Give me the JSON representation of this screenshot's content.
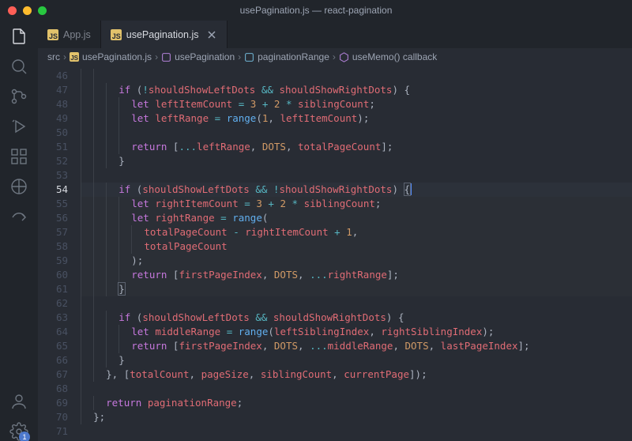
{
  "window": {
    "title": "usePagination.js — react-pagination"
  },
  "tabs": [
    {
      "label": "App.js",
      "active": false
    },
    {
      "label": "usePagination.js",
      "active": true
    }
  ],
  "breadcrumbs": {
    "root": "src",
    "file": "usePagination.js",
    "symbols": [
      "usePagination",
      "paginationRange",
      "useMemo() callback"
    ]
  },
  "activitybar": {
    "settings_badge": "1"
  },
  "editor": {
    "active_line": 54,
    "lines": [
      {
        "n": 46,
        "i": 2,
        "t": []
      },
      {
        "n": 47,
        "i": 3,
        "t": [
          [
            "kw",
            "if"
          ],
          [
            "punc",
            " ("
          ],
          [
            "op",
            "!"
          ],
          [
            "var",
            "shouldShowLeftDots"
          ],
          [
            "punc",
            " "
          ],
          [
            "op",
            "&&"
          ],
          [
            "punc",
            " "
          ],
          [
            "var",
            "shouldShowRightDots"
          ],
          [
            "punc",
            ") {"
          ]
        ]
      },
      {
        "n": 48,
        "i": 4,
        "t": [
          [
            "kw",
            "let"
          ],
          [
            "punc",
            " "
          ],
          [
            "var",
            "leftItemCount"
          ],
          [
            "punc",
            " "
          ],
          [
            "op",
            "="
          ],
          [
            "punc",
            " "
          ],
          [
            "num",
            "3"
          ],
          [
            "punc",
            " "
          ],
          [
            "op",
            "+"
          ],
          [
            "punc",
            " "
          ],
          [
            "num",
            "2"
          ],
          [
            "punc",
            " "
          ],
          [
            "op",
            "*"
          ],
          [
            "punc",
            " "
          ],
          [
            "var",
            "siblingCount"
          ],
          [
            "punc",
            ";"
          ]
        ]
      },
      {
        "n": 49,
        "i": 4,
        "t": [
          [
            "kw",
            "let"
          ],
          [
            "punc",
            " "
          ],
          [
            "var",
            "leftRange"
          ],
          [
            "punc",
            " "
          ],
          [
            "op",
            "="
          ],
          [
            "punc",
            " "
          ],
          [
            "fn",
            "range"
          ],
          [
            "punc",
            "("
          ],
          [
            "num",
            "1"
          ],
          [
            "punc",
            ", "
          ],
          [
            "var",
            "leftItemCount"
          ],
          [
            "punc",
            ");"
          ]
        ]
      },
      {
        "n": 50,
        "i": 4,
        "t": []
      },
      {
        "n": 51,
        "i": 4,
        "t": [
          [
            "kw",
            "return"
          ],
          [
            "punc",
            " ["
          ],
          [
            "op",
            "..."
          ],
          [
            "var",
            "leftRange"
          ],
          [
            "punc",
            ", "
          ],
          [
            "const",
            "DOTS"
          ],
          [
            "punc",
            ", "
          ],
          [
            "var",
            "totalPageCount"
          ],
          [
            "punc",
            "];"
          ]
        ]
      },
      {
        "n": 52,
        "i": 3,
        "t": [
          [
            "punc",
            "}"
          ]
        ]
      },
      {
        "n": 53,
        "i": 2,
        "t": []
      },
      {
        "n": 54,
        "i": 3,
        "hl": true,
        "t": [
          [
            "kw",
            "if"
          ],
          [
            "punc",
            " ("
          ],
          [
            "var",
            "shouldShowLeftDots"
          ],
          [
            "punc",
            " "
          ],
          [
            "op",
            "&&"
          ],
          [
            "punc",
            " "
          ],
          [
            "op",
            "!"
          ],
          [
            "var",
            "shouldShowRightDots"
          ],
          [
            "punc",
            ") "
          ],
          [
            "br",
            "{"
          ],
          [
            "cursor",
            ""
          ]
        ]
      },
      {
        "n": 55,
        "i": 4,
        "blk": true,
        "t": [
          [
            "kw",
            "let"
          ],
          [
            "punc",
            " "
          ],
          [
            "var",
            "rightItemCount"
          ],
          [
            "punc",
            " "
          ],
          [
            "op",
            "="
          ],
          [
            "punc",
            " "
          ],
          [
            "num",
            "3"
          ],
          [
            "punc",
            " "
          ],
          [
            "op",
            "+"
          ],
          [
            "punc",
            " "
          ],
          [
            "num",
            "2"
          ],
          [
            "punc",
            " "
          ],
          [
            "op",
            "*"
          ],
          [
            "punc",
            " "
          ],
          [
            "var",
            "siblingCount"
          ],
          [
            "punc",
            ";"
          ]
        ]
      },
      {
        "n": 56,
        "i": 4,
        "blk": true,
        "t": [
          [
            "kw",
            "let"
          ],
          [
            "punc",
            " "
          ],
          [
            "var",
            "rightRange"
          ],
          [
            "punc",
            " "
          ],
          [
            "op",
            "="
          ],
          [
            "punc",
            " "
          ],
          [
            "fn",
            "range"
          ],
          [
            "punc",
            "("
          ]
        ]
      },
      {
        "n": 57,
        "i": 5,
        "blk": true,
        "t": [
          [
            "var",
            "totalPageCount"
          ],
          [
            "punc",
            " "
          ],
          [
            "op",
            "-"
          ],
          [
            "punc",
            " "
          ],
          [
            "var",
            "rightItemCount"
          ],
          [
            "punc",
            " "
          ],
          [
            "op",
            "+"
          ],
          [
            "punc",
            " "
          ],
          [
            "num",
            "1"
          ],
          [
            "punc",
            ","
          ]
        ]
      },
      {
        "n": 58,
        "i": 5,
        "blk": true,
        "t": [
          [
            "var",
            "totalPageCount"
          ]
        ]
      },
      {
        "n": 59,
        "i": 4,
        "blk": true,
        "t": [
          [
            "punc",
            ");"
          ]
        ]
      },
      {
        "n": 60,
        "i": 4,
        "blk": true,
        "t": [
          [
            "kw",
            "return"
          ],
          [
            "punc",
            " ["
          ],
          [
            "var",
            "firstPageIndex"
          ],
          [
            "punc",
            ", "
          ],
          [
            "const",
            "DOTS"
          ],
          [
            "punc",
            ", "
          ],
          [
            "op",
            "..."
          ],
          [
            "var",
            "rightRange"
          ],
          [
            "punc",
            "];"
          ]
        ]
      },
      {
        "n": 61,
        "i": 3,
        "blk": true,
        "t": [
          [
            "br",
            "}"
          ]
        ]
      },
      {
        "n": 62,
        "i": 2,
        "t": []
      },
      {
        "n": 63,
        "i": 3,
        "t": [
          [
            "kw",
            "if"
          ],
          [
            "punc",
            " ("
          ],
          [
            "var",
            "shouldShowLeftDots"
          ],
          [
            "punc",
            " "
          ],
          [
            "op",
            "&&"
          ],
          [
            "punc",
            " "
          ],
          [
            "var",
            "shouldShowRightDots"
          ],
          [
            "punc",
            ") {"
          ]
        ]
      },
      {
        "n": 64,
        "i": 4,
        "t": [
          [
            "kw",
            "let"
          ],
          [
            "punc",
            " "
          ],
          [
            "var",
            "middleRange"
          ],
          [
            "punc",
            " "
          ],
          [
            "op",
            "="
          ],
          [
            "punc",
            " "
          ],
          [
            "fn",
            "range"
          ],
          [
            "punc",
            "("
          ],
          [
            "var",
            "leftSiblingIndex"
          ],
          [
            "punc",
            ", "
          ],
          [
            "var",
            "rightSiblingIndex"
          ],
          [
            "punc",
            ");"
          ]
        ]
      },
      {
        "n": 65,
        "i": 4,
        "t": [
          [
            "kw",
            "return"
          ],
          [
            "punc",
            " ["
          ],
          [
            "var",
            "firstPageIndex"
          ],
          [
            "punc",
            ", "
          ],
          [
            "const",
            "DOTS"
          ],
          [
            "punc",
            ", "
          ],
          [
            "op",
            "..."
          ],
          [
            "var",
            "middleRange"
          ],
          [
            "punc",
            ", "
          ],
          [
            "const",
            "DOTS"
          ],
          [
            "punc",
            ", "
          ],
          [
            "var",
            "lastPageIndex"
          ],
          [
            "punc",
            "];"
          ]
        ]
      },
      {
        "n": 66,
        "i": 3,
        "t": [
          [
            "punc",
            "}"
          ]
        ]
      },
      {
        "n": 67,
        "i": 2,
        "t": [
          [
            "punc",
            "}, ["
          ],
          [
            "var",
            "totalCount"
          ],
          [
            "punc",
            ", "
          ],
          [
            "var",
            "pageSize"
          ],
          [
            "punc",
            ", "
          ],
          [
            "var",
            "siblingCount"
          ],
          [
            "punc",
            ", "
          ],
          [
            "var",
            "currentPage"
          ],
          [
            "punc",
            "]);"
          ]
        ]
      },
      {
        "n": 68,
        "i": 1,
        "t": []
      },
      {
        "n": 69,
        "i": 2,
        "t": [
          [
            "kw",
            "return"
          ],
          [
            "punc",
            " "
          ],
          [
            "var",
            "paginationRange"
          ],
          [
            "punc",
            ";"
          ]
        ]
      },
      {
        "n": 70,
        "i": 1,
        "t": [
          [
            "punc",
            "};"
          ]
        ]
      },
      {
        "n": 71,
        "i": 0,
        "t": []
      }
    ]
  }
}
